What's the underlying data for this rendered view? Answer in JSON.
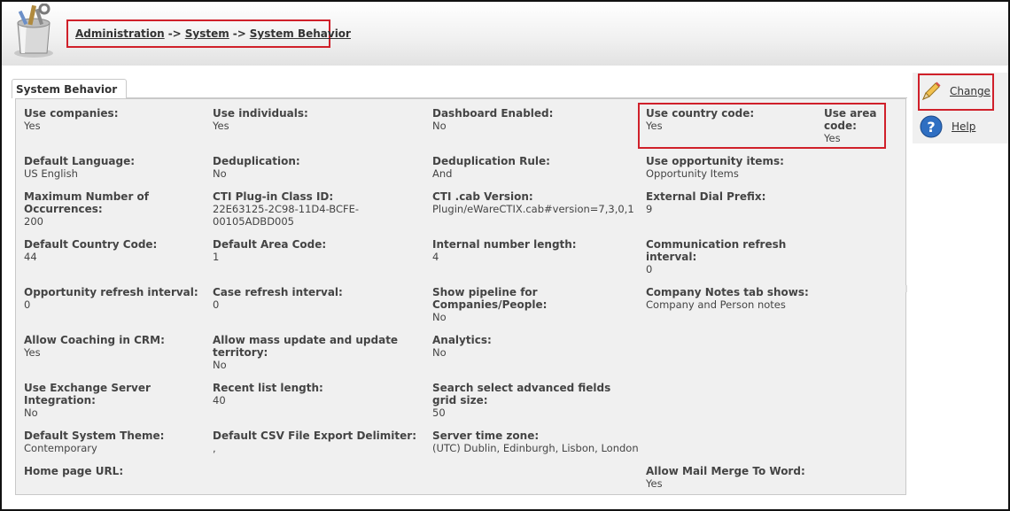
{
  "breadcrumb": {
    "items": [
      "Administration",
      "System",
      "System Behavior"
    ],
    "separator": "->"
  },
  "tab": {
    "label": "System Behavior"
  },
  "side_actions": {
    "change_label": "Change",
    "help_label": "Help"
  },
  "fields": [
    {
      "label": "Use companies:",
      "value": "Yes"
    },
    {
      "label": "Use individuals:",
      "value": "Yes"
    },
    {
      "label": "Dashboard Enabled:",
      "value": "No"
    },
    {
      "label": "Use country code:",
      "value": "Yes"
    },
    {
      "label": "Use area code:",
      "value": "Yes"
    },
    {
      "label": "Default Language:",
      "value": "US English"
    },
    {
      "label": "Deduplication:",
      "value": "No"
    },
    {
      "label": "Deduplication Rule:",
      "value": "And"
    },
    {
      "label": "Use opportunity items:",
      "value": "Opportunity Items"
    },
    {
      "label": "Maximum Number of Occurrences:",
      "value": "200"
    },
    {
      "label": "CTI Plug-in Class ID:",
      "value": "22E63125-2C98-11D4-BCFE-00105ADBD005"
    },
    {
      "label": "CTI .cab Version:",
      "value": "Plugin/eWareCTIX.cab#version=7,3,0,1"
    },
    {
      "label": "External Dial Prefix:",
      "value": "9"
    },
    {
      "label": "Default Country Code:",
      "value": "44"
    },
    {
      "label": "Default Area Code:",
      "value": "1"
    },
    {
      "label": "Internal number length:",
      "value": "4"
    },
    {
      "label": "Communication refresh interval:",
      "value": "0"
    },
    {
      "label": "Opportunity refresh interval:",
      "value": "0"
    },
    {
      "label": "Case refresh interval:",
      "value": "0"
    },
    {
      "label": "Show pipeline for Companies/People:",
      "value": "No"
    },
    {
      "label": "Company Notes tab shows:",
      "value": "Company and Person notes"
    },
    {
      "label": "Allow Coaching in CRM:",
      "value": "Yes"
    },
    {
      "label": "Allow mass update and update territory:",
      "value": "No"
    },
    {
      "label": "Analytics:",
      "value": "No"
    },
    {
      "label": "Use Exchange Server Integration:",
      "value": "No"
    },
    {
      "label": "Recent list length:",
      "value": "40"
    },
    {
      "label": "Search select advanced fields grid size:",
      "value": "50"
    },
    {
      "label": "Default System Theme:",
      "value": "Contemporary"
    },
    {
      "label": "Default CSV File Export Delimiter:",
      "value": ","
    },
    {
      "label": "Server time zone:",
      "value": "(UTC) Dublin, Edinburgh, Lisbon, London"
    },
    {
      "label": "Home page URL:",
      "value": ""
    },
    {
      "label": "Allow Mail Merge To Word:",
      "value": "Yes"
    }
  ]
}
